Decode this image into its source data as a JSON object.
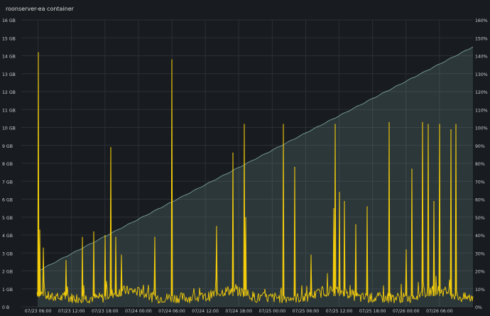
{
  "panel": {
    "title": "roonserver-ea container"
  },
  "chart_data": {
    "type": "line",
    "title": "roonserver-ea container",
    "x_ticks": [
      "07/23 06:00",
      "07/23 12:00",
      "07/23 18:00",
      "07/24 00:00",
      "07/24 06:00",
      "07/24 12:00",
      "07/24 18:00",
      "07/25 00:00",
      "07/25 06:00",
      "07/25 12:00",
      "07/25 18:00",
      "07/26 00:00",
      "07/26 06:00"
    ],
    "x_range": [
      "07/23 03:00",
      "07/26 12:00"
    ],
    "left_axis": {
      "ticks": [
        "0 B",
        "1 GB",
        "2 GB",
        "3 GB",
        "4 GB",
        "5 GB",
        "6 GB",
        "7 GB",
        "8 GB",
        "9 GB",
        "10 GB",
        "11 GB",
        "12 GB",
        "13 GB",
        "14 GB",
        "15 GB",
        "16 GB"
      ],
      "range_gb": [
        0,
        16
      ]
    },
    "right_axis": {
      "ticks": [
        "0%",
        "10%",
        "20%",
        "30%",
        "40%",
        "50%",
        "60%",
        "70%",
        "80%",
        "90%",
        "100%",
        "110%",
        "120%",
        "130%",
        "140%",
        "150%",
        "160%"
      ],
      "range_pct": [
        0,
        160
      ]
    },
    "series": [
      {
        "axis": "left",
        "style": "area",
        "color": "#8ab8b0",
        "start": {
          "t": "07/23 06:00",
          "gb": 2.0
        },
        "end": {
          "t": "07/26 12:00",
          "gb": 14.5
        }
      },
      {
        "axis": "right",
        "style": "line",
        "color": "#f2cc0c",
        "baseline_pct": [
          2,
          8
        ],
        "spikes": [
          {
            "t": "07/23 06:00",
            "pct": 142
          },
          {
            "t": "07/23 06:00",
            "pct": 43
          },
          {
            "t": "07/23 07:00",
            "pct": 33
          },
          {
            "t": "07/23 11:00",
            "pct": 26
          },
          {
            "t": "07/23 14:00",
            "pct": 39
          },
          {
            "t": "07/23 16:00",
            "pct": 42
          },
          {
            "t": "07/23 18:00",
            "pct": 40
          },
          {
            "t": "07/23 19:00",
            "pct": 89
          },
          {
            "t": "07/23 20:00",
            "pct": 39
          },
          {
            "t": "07/23 21:00",
            "pct": 29
          },
          {
            "t": "07/24 03:00",
            "pct": 39
          },
          {
            "t": "07/24 06:00",
            "pct": 138
          },
          {
            "t": "07/24 14:00",
            "pct": 45
          },
          {
            "t": "07/24 17:00",
            "pct": 86
          },
          {
            "t": "07/24 19:00",
            "pct": 102
          },
          {
            "t": "07/24 19:00",
            "pct": 50
          },
          {
            "t": "07/25 02:00",
            "pct": 102
          },
          {
            "t": "07/25 04:00",
            "pct": 78
          },
          {
            "t": "07/25 07:00",
            "pct": 29
          },
          {
            "t": "07/25 11:00",
            "pct": 55
          },
          {
            "t": "07/25 11:00",
            "pct": 102
          },
          {
            "t": "07/25 12:00",
            "pct": 64
          },
          {
            "t": "07/25 13:00",
            "pct": 59
          },
          {
            "t": "07/25 15:00",
            "pct": 46
          },
          {
            "t": "07/25 17:00",
            "pct": 56
          },
          {
            "t": "07/25 21:00",
            "pct": 103
          },
          {
            "t": "07/26 00:00",
            "pct": 32
          },
          {
            "t": "07/26 01:00",
            "pct": 77
          },
          {
            "t": "07/26 03:00",
            "pct": 103
          },
          {
            "t": "07/26 04:00",
            "pct": 102
          },
          {
            "t": "07/26 05:00",
            "pct": 59
          },
          {
            "t": "07/26 06:00",
            "pct": 102
          },
          {
            "t": "07/26 08:00",
            "pct": 99
          },
          {
            "t": "07/26 09:00",
            "pct": 102
          }
        ]
      }
    ],
    "grid": true
  }
}
